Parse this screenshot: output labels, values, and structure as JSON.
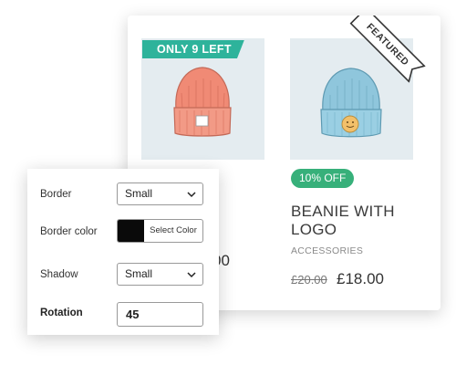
{
  "products": [
    {
      "badge": "ONLY 9 LEFT",
      "price_fragment": "00",
      "hat_color": "#f08a75"
    },
    {
      "ribbon": "FEATURED",
      "discount_badge": "10% OFF",
      "title": "BEANIE WITH LOGO",
      "category": "ACCESSORIES",
      "price_old": "£20.00",
      "price_new": "£18.00",
      "hat_color": "#8fc6dc"
    }
  ],
  "settings": {
    "border_label": "Border",
    "border_value": "Small",
    "border_color_label": "Border color",
    "select_color_button": "Select Color",
    "border_color_value": "#0a0a0a",
    "shadow_label": "Shadow",
    "shadow_value": "Small",
    "rotation_label": "Rotation",
    "rotation_value": "45"
  },
  "colors": {
    "stock_badge": "#2eb39b",
    "discount_badge": "#37b07a",
    "image_bg": "#e4ecf0"
  }
}
